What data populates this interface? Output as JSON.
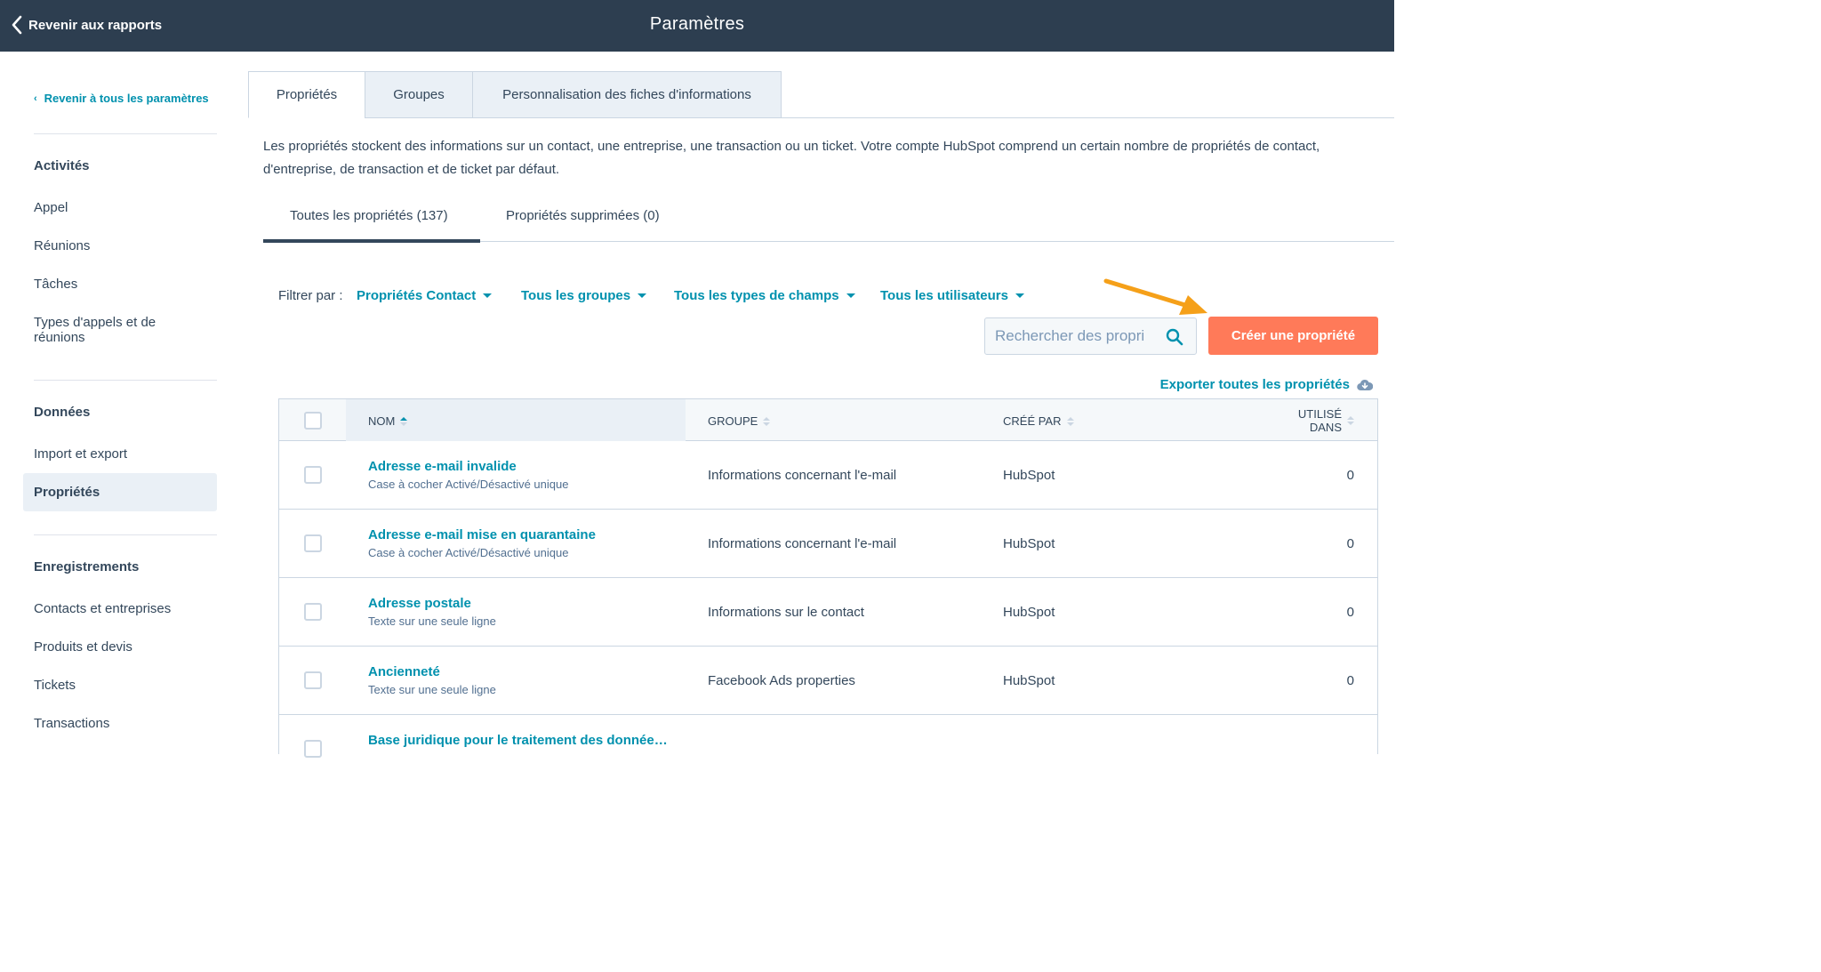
{
  "topbar": {
    "back_label": "Revenir aux rapports",
    "title": "Paramètres"
  },
  "sidebar": {
    "back_label": "Revenir à tous les paramètres",
    "sections": [
      {
        "heading": "Activités",
        "items": [
          "Appel",
          "Réunions",
          "Tâches",
          "Types d'appels et de réunions"
        ]
      },
      {
        "heading": "Données",
        "items": [
          "Import et export",
          "Propriétés"
        ]
      },
      {
        "heading": "Enregistrements",
        "items": [
          "Contacts et entreprises",
          "Produits et devis",
          "Tickets",
          "Transactions"
        ]
      }
    ],
    "active_item": "Propriétés"
  },
  "tabs": [
    "Propriétés",
    "Groupes",
    "Personnalisation des fiches d'informations"
  ],
  "intro": "Les propriétés stockent des informations sur un contact, une entreprise, une transaction ou un ticket. Votre compte HubSpot comprend un certain nombre de propriétés de contact, d'entreprise, de transaction et de ticket par défaut.",
  "subtabs": [
    "Toutes les propriétés (137)",
    "Propriétés supprimées (0)"
  ],
  "filters": {
    "label": "Filtrer par :",
    "dropdowns": [
      "Propriétés Contact",
      "Tous les groupes",
      "Tous les types de champs",
      "Tous les utilisateurs"
    ]
  },
  "search": {
    "placeholder": "Rechercher des propri"
  },
  "create_button": "Créer une propriété",
  "export_label": "Exporter toutes les propriétés",
  "table": {
    "columns": [
      "NOM",
      "GROUPE",
      "CRÉÉ PAR",
      "UTILISÉ",
      "DANS"
    ],
    "rows": [
      {
        "name": "Adresse e-mail invalide",
        "type": "Case à cocher Activé/Désactivé unique",
        "group": "Informations concernant l'e-mail",
        "creator": "HubSpot",
        "used": "0"
      },
      {
        "name": "Adresse e-mail mise en quarantaine",
        "type": "Case à cocher Activé/Désactivé unique",
        "group": "Informations concernant l'e-mail",
        "creator": "HubSpot",
        "used": "0"
      },
      {
        "name": "Adresse postale",
        "type": "Texte sur une seule ligne",
        "group": "Informations sur le contact",
        "creator": "HubSpot",
        "used": "0"
      },
      {
        "name": "Ancienneté",
        "type": "Texte sur une seule ligne",
        "group": "Facebook Ads properties",
        "creator": "HubSpot",
        "used": "0"
      },
      {
        "name": "Base juridique pour le traitement des donnée…",
        "type": "",
        "group": "",
        "creator": "",
        "used": ""
      }
    ]
  },
  "colors": {
    "topbar": "#2d3e50",
    "link": "#0091ae",
    "cta": "#ff7a59",
    "annotation_arrow": "#f5a019"
  }
}
